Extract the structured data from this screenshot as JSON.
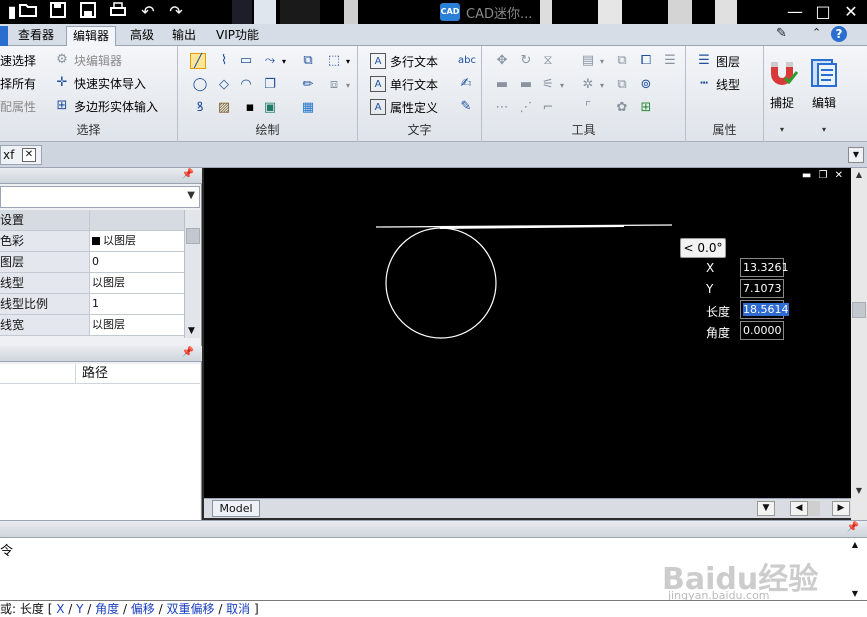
{
  "title_bar": {
    "app_badge": "CAD",
    "title": "CAD迷你...",
    "icons": [
      "open-folder-icon",
      "save-icon",
      "save-as-icon",
      "print-icon",
      "undo-icon",
      "redo-icon"
    ],
    "window_controls": [
      "minimize-icon",
      "maximize-icon",
      "close-icon"
    ]
  },
  "menu": {
    "tabs": [
      "查看器",
      "编辑器",
      "高级",
      "输出",
      "VIP功能"
    ],
    "active_tab": "编辑器",
    "help_label": "?"
  },
  "ribbon": {
    "select_group": {
      "label": "选择",
      "items": [
        "速选择",
        "择所有",
        "配属性",
        "块编辑器",
        "快速实体导入",
        "多边形实体输入"
      ]
    },
    "draw_group": {
      "label": "绘制"
    },
    "text_group": {
      "label": "文字",
      "items": [
        "多行文本",
        "单行文本",
        "属性定义"
      ]
    },
    "tools_group": {
      "label": "工具"
    },
    "props_group": {
      "label": "属性",
      "items": [
        "图层",
        "线型"
      ]
    },
    "big_buttons": [
      "捕捉",
      "编辑"
    ]
  },
  "doc_tab": {
    "label": "xf",
    "close": "✕"
  },
  "properties": {
    "rows": [
      {
        "key": "设置",
        "value": ""
      },
      {
        "key": "色彩",
        "value": "以图层",
        "swatch": true
      },
      {
        "key": "图层",
        "value": "0"
      },
      {
        "key": "线型",
        "value": "以图层"
      },
      {
        "key": "线型比例",
        "value": "1"
      },
      {
        "key": "线宽",
        "value": "以图层"
      }
    ],
    "list_header": {
      "col1": "",
      "col2": "路径"
    }
  },
  "canvas": {
    "angle_tooltip": "< 0.0°",
    "fields": [
      {
        "label": "X",
        "value": "13.3261"
      },
      {
        "label": "Y",
        "value": "7.1073"
      },
      {
        "label": "长度",
        "value": "18.5614",
        "selected": true
      },
      {
        "label": "角度",
        "value": "0.0000"
      }
    ],
    "model_tab": "Model"
  },
  "command": {
    "history_line": "令",
    "watermark": "Baidu经验",
    "watermark_sub": "jingyan.baidu.com",
    "prompt_prefix": "或: 长度",
    "options": [
      "X",
      "Y",
      "角度",
      "偏移",
      "双重偏移",
      "取消"
    ]
  }
}
